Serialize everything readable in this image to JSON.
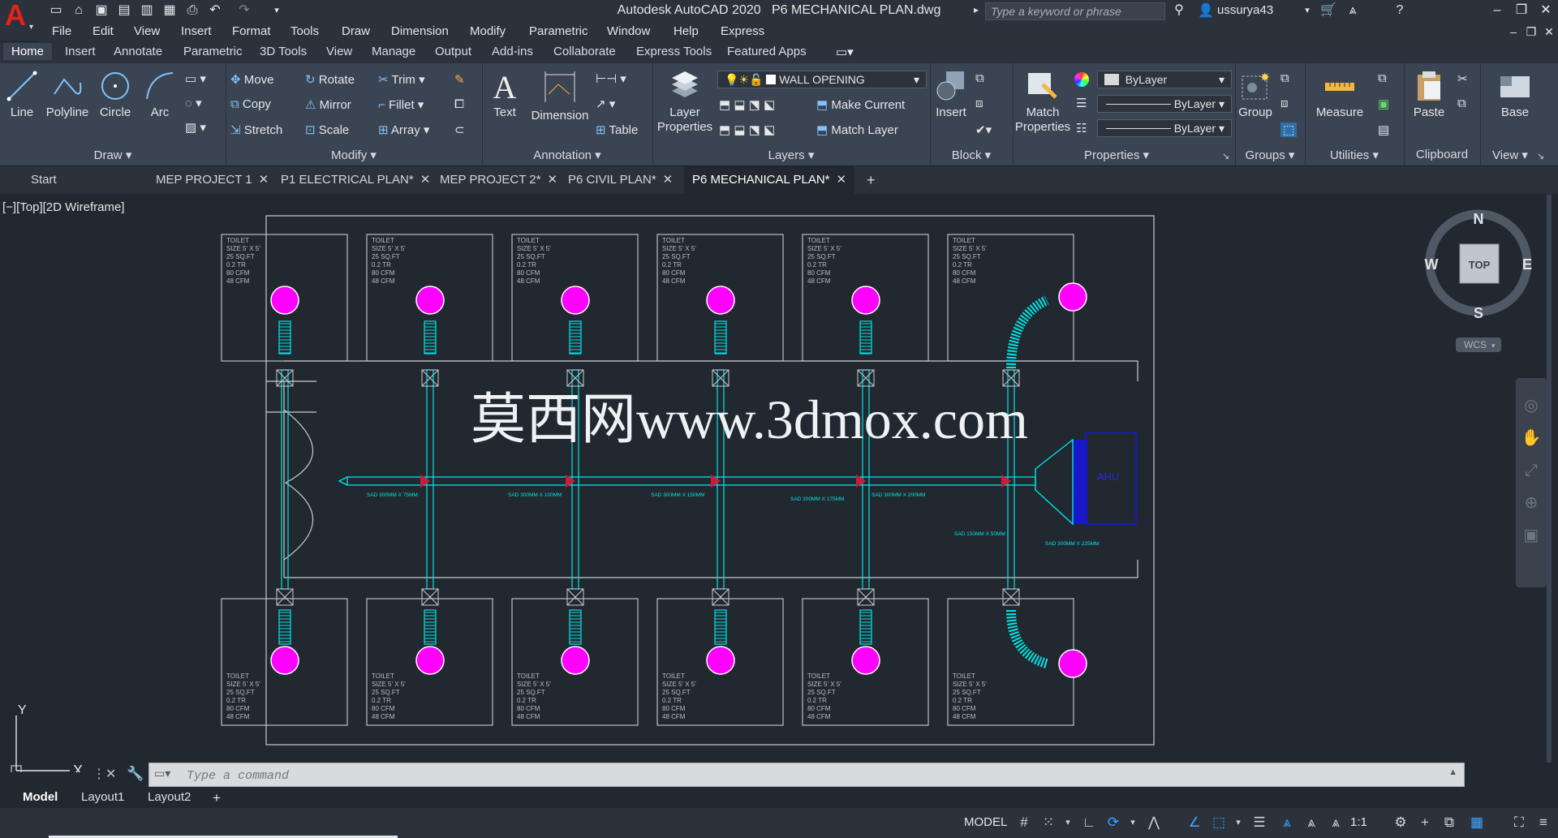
{
  "app": {
    "title": "Autodesk AutoCAD 2020",
    "document": "P6 MECHANICAL PLAN.dwg",
    "search_placeholder": "Type a keyword or phrase",
    "user": "ussurya43"
  },
  "menubar": [
    "File",
    "Edit",
    "View",
    "Insert",
    "Format",
    "Tools",
    "Draw",
    "Dimension",
    "Modify",
    "Parametric",
    "Window",
    "Help",
    "Express"
  ],
  "ribbon_tabs": [
    "Home",
    "Insert",
    "Annotate",
    "Parametric",
    "3D Tools",
    "View",
    "Manage",
    "Output",
    "Add-ins",
    "Collaborate",
    "Express Tools",
    "Featured Apps"
  ],
  "ribbon": {
    "draw": {
      "title": "Draw",
      "line": "Line",
      "polyline": "Polyline",
      "circle": "Circle",
      "arc": "Arc"
    },
    "modify": {
      "title": "Modify",
      "move": "Move",
      "rotate": "Rotate",
      "trim": "Trim",
      "copy": "Copy",
      "mirror": "Mirror",
      "fillet": "Fillet",
      "stretch": "Stretch",
      "scale": "Scale",
      "array": "Array"
    },
    "annotation": {
      "title": "Annotation",
      "text": "Text",
      "dimension": "Dimension",
      "table": "Table"
    },
    "layers": {
      "title": "Layers",
      "layer_properties": "Layer Properties",
      "current_layer": "WALL OPENING",
      "make_current": "Make Current",
      "match_layer": "Match Layer"
    },
    "block": {
      "title": "Block",
      "insert": "Insert"
    },
    "properties": {
      "title": "Properties",
      "match": "Match Properties",
      "color": "ByLayer",
      "linetype": "ByLayer",
      "lineweight": "ByLayer"
    },
    "groups": {
      "title": "Groups",
      "group": "Group"
    },
    "utilities": {
      "title": "Utilities",
      "measure": "Measure"
    },
    "clipboard": {
      "title": "Clipboard",
      "paste": "Paste"
    },
    "view": {
      "title": "View",
      "base": "Base"
    }
  },
  "file_tabs": [
    {
      "label": "Start",
      "closable": false
    },
    {
      "label": "MEP PROJECT 1",
      "closable": true
    },
    {
      "label": "P1 ELECTRICAL PLAN*",
      "closable": true
    },
    {
      "label": "MEP PROJECT 2*",
      "closable": true
    },
    {
      "label": "P6 CIVIL PLAN*",
      "closable": true
    },
    {
      "label": "P6 MECHANICAL PLAN*",
      "closable": true,
      "active": true
    }
  ],
  "viewport": {
    "label": "[−][Top][2D Wireframe]",
    "viewcube": {
      "north": "N",
      "south": "S",
      "east": "E",
      "west": "W",
      "face": "TOP",
      "ucs": "WCS"
    },
    "ucs_icon": {
      "y": "Y",
      "x": "X"
    },
    "watermark": "莫西网www.3dmox.com"
  },
  "drawing": {
    "room_label": [
      "TOILET",
      "SIZE 5' X 5'",
      "25 SQ.FT",
      "0.2 TR",
      "80 CFM",
      "48 CFM"
    ],
    "duct_labels": [
      "SAD 300MM X 75MM",
      "SAD 300MM X 100MM",
      "SAD 300MM X 150MM",
      "SAD 300MM X 175MM",
      "SAD 300MM X 200MM",
      "SAD 150MM X 50MM",
      "SAD 300MM X 225MM"
    ],
    "ahu_label": "AHU"
  },
  "command": {
    "placeholder": "Type a command"
  },
  "layout_tabs": [
    "Model",
    "Layout1",
    "Layout2"
  ],
  "status": {
    "model": "MODEL",
    "scale": "1:1"
  },
  "colors": {
    "diffuser": "#ff00ff",
    "duct": "#00e5e5",
    "wall": "#c9ccd1",
    "ahu": "#1818c8",
    "damper": "#c81e3c",
    "background": "#212830"
  }
}
